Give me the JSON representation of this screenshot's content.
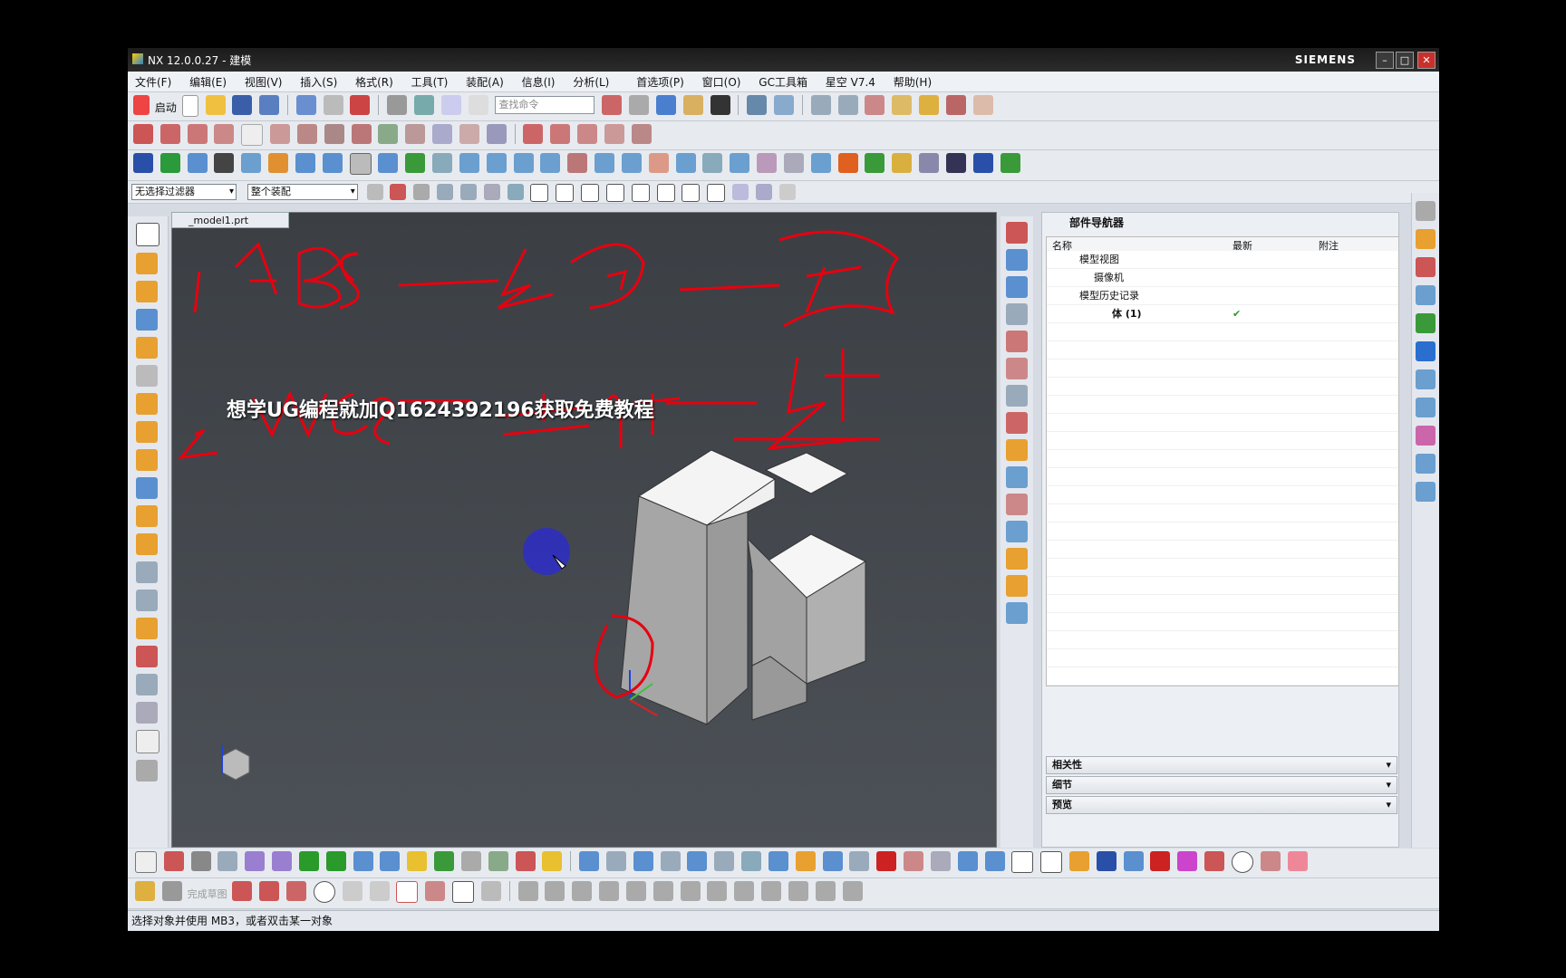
{
  "window": {
    "title": "NX 12.0.0.27 - 建模",
    "brand": "SIEMENS",
    "min": "–",
    "max": "□",
    "close": "✕"
  },
  "menu": [
    "文件(F)",
    "编辑(E)",
    "视图(V)",
    "插入(S)",
    "格式(R)",
    "工具(T)",
    "装配(A)",
    "信息(I)",
    "分析(L)",
    "首选项(P)",
    "窗口(O)",
    "GC工具箱",
    "星空 V7.4",
    "帮助(H)"
  ],
  "toolbar": {
    "start_label": "启动",
    "search_placeholder": "查找命令"
  },
  "selection": {
    "filter": "无选择过滤器",
    "scope": "整个装配"
  },
  "viewport": {
    "tab_label": "_model1.prt",
    "watermark": "想学UG编程就加Q1624392196获取免费教程",
    "annotation_line1": "1. ABS — 绝 — 固",
    "annotation_line2": "2. WCS — 工作 — 基",
    "annotation_extra": "— 编 义了",
    "annotation_top": "基"
  },
  "navigator": {
    "title": "部件导航器",
    "columns": [
      "名称",
      "最新",
      "附注"
    ],
    "rows": [
      {
        "label": "模型视图",
        "latest": ""
      },
      {
        "label": "摄像机",
        "latest": ""
      },
      {
        "label": "模型历史记录",
        "latest": ""
      },
      {
        "label": "体 (1)",
        "latest": "✔"
      }
    ],
    "panels": [
      "相关性",
      "细节",
      "预览"
    ]
  },
  "bottom_toolbar": {
    "finish_sketch": "完成草图"
  },
  "status": {
    "message": "选择对象并使用 MB3，或者双击某一对象"
  },
  "colors": {
    "annotation": "#e8000f",
    "viewport_bg": "#45494f",
    "cursor": "#2d2dc8"
  }
}
